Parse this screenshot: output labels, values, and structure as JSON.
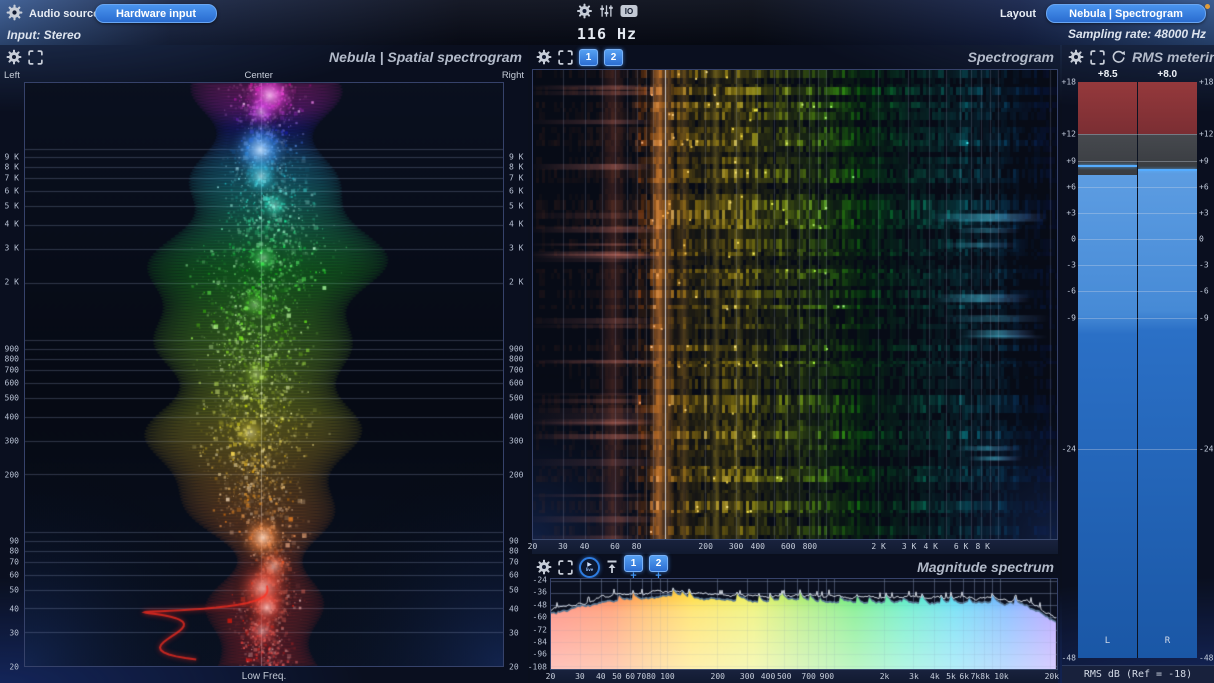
{
  "topbar": {
    "audio_source_label": "Audio source",
    "hardware_input_button": "Hardware input",
    "input_label": "Input: Stereo",
    "frequency_readout": "116 Hz",
    "io_icon_label": "IO",
    "layout_label": "Layout",
    "layout_button": "Nebula | Spectrogram",
    "sampling_rate_label": "Sampling rate: 48000 Hz"
  },
  "spatial": {
    "title": "Nebula | Spatial spectrogram",
    "pan_labels": {
      "left": "Left",
      "center": "Center",
      "right": "Right"
    },
    "bottom_label": "Low Freq.",
    "freq_ticks": [
      {
        "f": 9000,
        "label": "9 K"
      },
      {
        "f": 8000,
        "label": "8 K"
      },
      {
        "f": 7000,
        "label": "7 K"
      },
      {
        "f": 6000,
        "label": "6 K"
      },
      {
        "f": 5000,
        "label": "5 K"
      },
      {
        "f": 4000,
        "label": "4 K"
      },
      {
        "f": 3000,
        "label": "3 K"
      },
      {
        "f": 2000,
        "label": "2 K"
      },
      {
        "f": 900,
        "label": "900"
      },
      {
        "f": 800,
        "label": "800"
      },
      {
        "f": 700,
        "label": "700"
      },
      {
        "f": 600,
        "label": "600"
      },
      {
        "f": 500,
        "label": "500"
      },
      {
        "f": 400,
        "label": "400"
      },
      {
        "f": 300,
        "label": "300"
      },
      {
        "f": 200,
        "label": "200"
      },
      {
        "f": 90,
        "label": "90"
      },
      {
        "f": 80,
        "label": "80"
      },
      {
        "f": 70,
        "label": "70"
      },
      {
        "f": 60,
        "label": "60"
      },
      {
        "f": 50,
        "label": "50"
      },
      {
        "f": 40,
        "label": "40"
      },
      {
        "f": 30,
        "label": "30"
      },
      {
        "f": 20,
        "label": "20"
      }
    ]
  },
  "spectrogram": {
    "title": "Spectrogram",
    "buttons": [
      "1",
      "2"
    ],
    "cursor_freq_hz": 116,
    "freq_ticks": [
      {
        "f": 20,
        "label": "20"
      },
      {
        "f": 30,
        "label": "30"
      },
      {
        "f": 40,
        "label": "40"
      },
      {
        "f": 60,
        "label": "60"
      },
      {
        "f": 80,
        "label": "80"
      },
      {
        "f": 200,
        "label": "200"
      },
      {
        "f": 300,
        "label": "300"
      },
      {
        "f": 400,
        "label": "400"
      },
      {
        "f": 600,
        "label": "600"
      },
      {
        "f": 800,
        "label": "800"
      },
      {
        "f": 2000,
        "label": "2 K"
      },
      {
        "f": 3000,
        "label": "3 K"
      },
      {
        "f": 4000,
        "label": "4 K"
      },
      {
        "f": 6000,
        "label": "6 K"
      },
      {
        "f": 8000,
        "label": "8 K"
      }
    ]
  },
  "magnitude": {
    "title": "Magnitude spectrum",
    "live_button_label": "live",
    "buttons": [
      "1",
      "2"
    ],
    "add_label": "+",
    "db_ticks": [
      {
        "db": -24,
        "label": "-24"
      },
      {
        "db": -36,
        "label": "-36"
      },
      {
        "db": -48,
        "label": "-48"
      },
      {
        "db": -60,
        "label": "-60"
      },
      {
        "db": -72,
        "label": "-72"
      },
      {
        "db": -84,
        "label": "-84"
      },
      {
        "db": -96,
        "label": "-96"
      },
      {
        "db": -108,
        "label": "-108"
      }
    ],
    "freq_ticks": [
      {
        "f": 20,
        "label": "20"
      },
      {
        "f": 30,
        "label": "30"
      },
      {
        "f": 40,
        "label": "40"
      },
      {
        "f": 50,
        "label": "50"
      },
      {
        "f": 60,
        "label": "60"
      },
      {
        "f": 70,
        "label": "70"
      },
      {
        "f": 80,
        "label": "80"
      },
      {
        "f": 100,
        "label": "100"
      },
      {
        "f": 200,
        "label": "200"
      },
      {
        "f": 300,
        "label": "300"
      },
      {
        "f": 400,
        "label": "400"
      },
      {
        "f": 500,
        "label": "500"
      },
      {
        "f": 700,
        "label": "700"
      },
      {
        "f": 900,
        "label": "900"
      },
      {
        "f": 2000,
        "label": "2k"
      },
      {
        "f": 3000,
        "label": "3k"
      },
      {
        "f": 4000,
        "label": "4k"
      },
      {
        "f": 5000,
        "label": "5k"
      },
      {
        "f": 6000,
        "label": "6k"
      },
      {
        "f": 7000,
        "label": "7k"
      },
      {
        "f": 8000,
        "label": "8k"
      },
      {
        "f": 10000,
        "label": "10k"
      },
      {
        "f": 20000,
        "label": "20k"
      }
    ]
  },
  "rms": {
    "title": "RMS metering",
    "footer": "RMS dB (Ref = -18)",
    "meters": [
      {
        "label": "L",
        "value_label": "+8.5",
        "value_db": 8.5,
        "fill_top_db": 7.4
      },
      {
        "label": "R",
        "value_label": "+8.0",
        "value_db": 8.0,
        "fill_top_db": 8.0
      }
    ],
    "scale_ticks": [
      {
        "v": 18,
        "label": "+18"
      },
      {
        "v": 12,
        "label": "+12"
      },
      {
        "v": 9,
        "label": "+9"
      },
      {
        "v": 6,
        "label": "+6"
      },
      {
        "v": 3,
        "label": "+3"
      },
      {
        "v": 0,
        "label": "0"
      },
      {
        "v": -3,
        "label": "-3"
      },
      {
        "v": -6,
        "label": "-6"
      },
      {
        "v": -9,
        "label": "-9"
      },
      {
        "v": -24,
        "label": "-24"
      },
      {
        "v": -48,
        "label": "-48"
      }
    ],
    "colors": {
      "red_zone": "#8a3438",
      "gray_zone": "#42454a",
      "meter_blue": "#4a8fd4",
      "meter_deep_blue": "#1d62b5",
      "marker": "#55acff"
    }
  }
}
